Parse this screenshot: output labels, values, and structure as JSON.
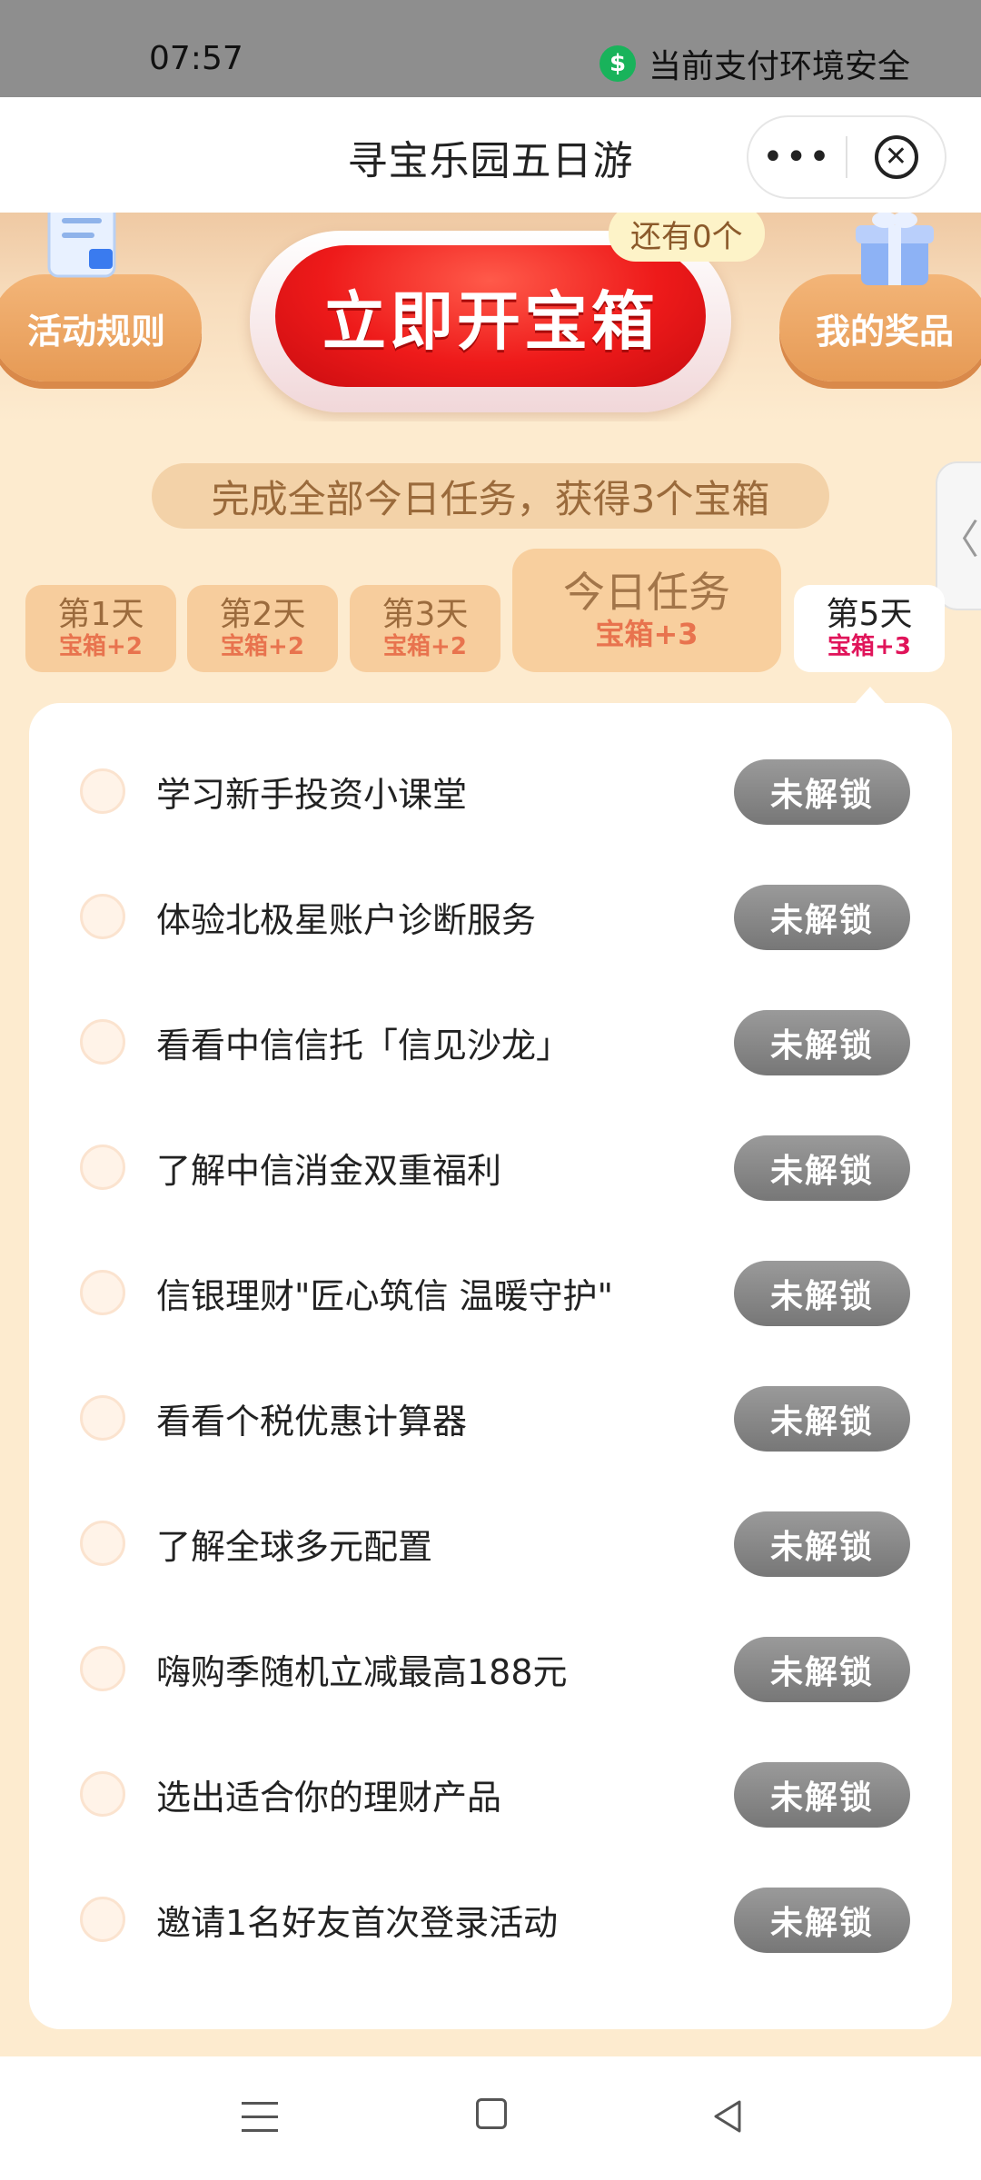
{
  "status_bar": {
    "time": "07:57",
    "security_text": "当前支付环境安全",
    "security_icon": "$"
  },
  "title_bar": {
    "title": "寻宝乐园五日游",
    "more_icon": "•••",
    "close_icon": "✕"
  },
  "hero": {
    "rules_label": "活动规则",
    "open_button_label": "立即开宝箱",
    "remaining_label": "还有0个",
    "prizes_label": "我的奖品"
  },
  "subtitle": "完成全部今日任务，获得3个宝箱",
  "side_tab_icon": "〈",
  "day_tabs": [
    {
      "name": "第1天",
      "bonus": "宝箱+2"
    },
    {
      "name": "第2天",
      "bonus": "宝箱+2"
    },
    {
      "name": "第3天",
      "bonus": "宝箱+2"
    },
    {
      "name": "今日任务",
      "bonus": "宝箱+3"
    },
    {
      "name": "第5天",
      "bonus": "宝箱+3"
    }
  ],
  "tasks": [
    {
      "title": "学习新手投资小课堂",
      "button": "未解锁"
    },
    {
      "title": "体验北极星账户诊断服务",
      "button": "未解锁"
    },
    {
      "title": "看看中信信托「信见沙龙」",
      "button": "未解锁"
    },
    {
      "title": "了解中信消金双重福利",
      "button": "未解锁"
    },
    {
      "title": "信银理财\"匠心筑信 温暖守护\"",
      "button": "未解锁"
    },
    {
      "title": "看看个税优惠计算器",
      "button": "未解锁"
    },
    {
      "title": "了解全球多元配置",
      "button": "未解锁"
    },
    {
      "title": "嗨购季随机立减最高188元",
      "button": "未解锁"
    },
    {
      "title": "选出适合你的理财产品",
      "button": "未解锁"
    },
    {
      "title": "邀请1名好友首次登录活动",
      "button": "未解锁"
    }
  ],
  "colors": {
    "page_background": "#fdebcf",
    "primary_red": "#ee1a1a",
    "locked_button": "#8a8a8a",
    "secure_green": "#19b35b"
  }
}
